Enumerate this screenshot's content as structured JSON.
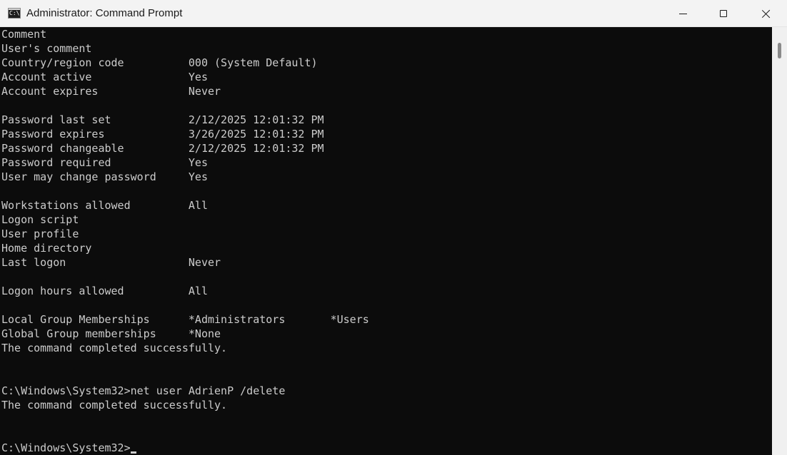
{
  "window": {
    "title": "Administrator: Command Prompt",
    "icon": "cmd-icon",
    "icon_text": "C:\\",
    "controls": [
      "minimize-icon",
      "maximize-icon",
      "close-icon"
    ]
  },
  "console": {
    "lines": [
      "Comment",
      "User's comment",
      "Country/region code          000 (System Default)",
      "Account active               Yes",
      "Account expires              Never",
      "",
      "Password last set            2/12/2025 12:01:32 PM",
      "Password expires             3/26/2025 12:01:32 PM",
      "Password changeable          2/12/2025 12:01:32 PM",
      "Password required            Yes",
      "User may change password     Yes",
      "",
      "Workstations allowed         All",
      "Logon script",
      "User profile",
      "Home directory",
      "Last logon                   Never",
      "",
      "Logon hours allowed          All",
      "",
      "Local Group Memberships      *Administrators       *Users",
      "Global Group memberships     *None",
      "The command completed successfully.",
      "",
      "",
      "C:\\Windows\\System32>net user AdrienP /delete",
      "The command completed successfully.",
      "",
      "",
      "C:\\Windows\\System32>"
    ]
  },
  "colors": {
    "console_background": "#0c0c0c",
    "console_text": "#cccccc",
    "titlebar_background": "#f3f3f3"
  }
}
